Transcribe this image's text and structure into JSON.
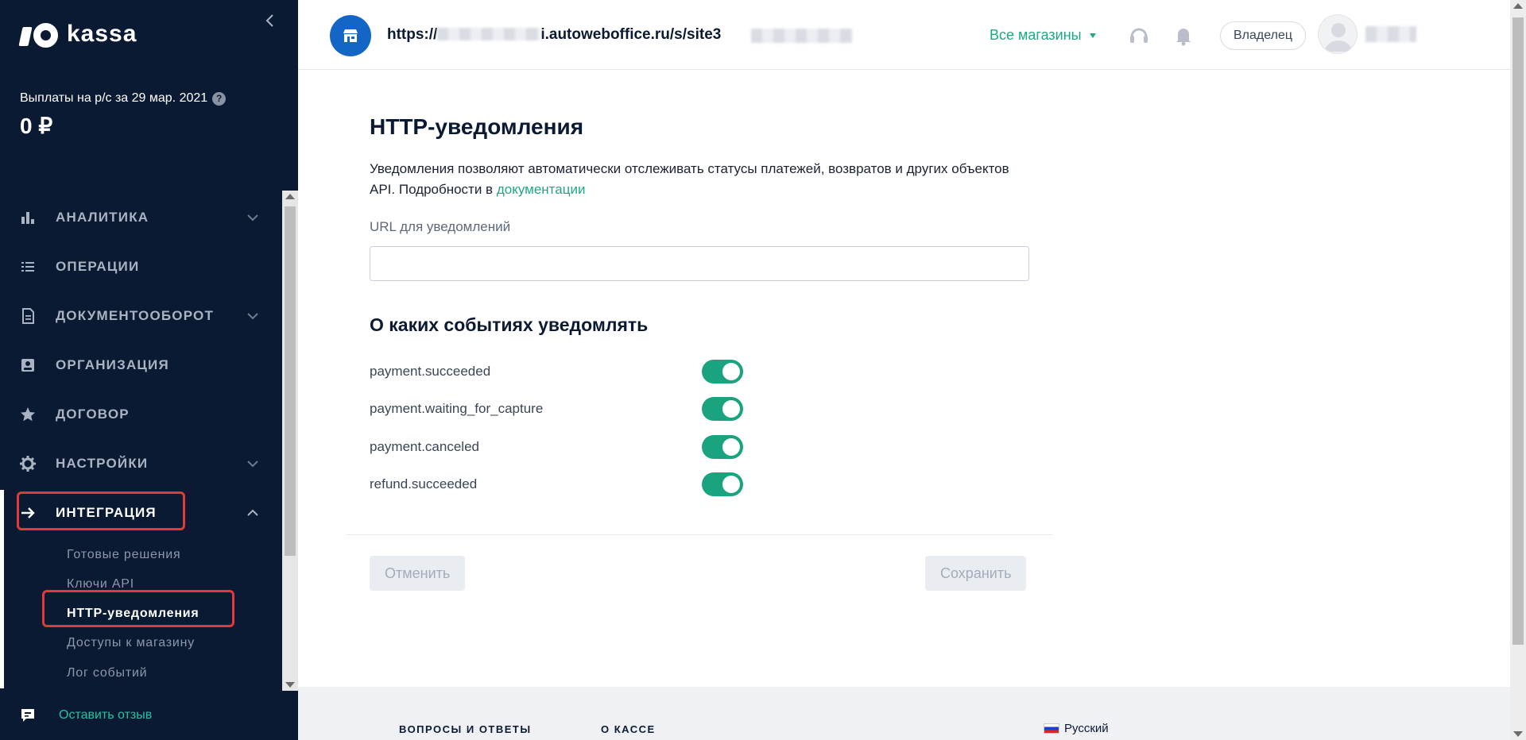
{
  "sidebar": {
    "logo_text": "kassa",
    "payout_label": "Выплаты на р/с за 29 мар. 2021",
    "payout_amount": "0 ₽",
    "nav": [
      {
        "label": "АНАЛИТИКА",
        "icon": "bar-chart-icon",
        "expandable": true
      },
      {
        "label": "ОПЕРАЦИИ",
        "icon": "list-icon",
        "expandable": false
      },
      {
        "label": "ДОКУМЕНТООБОРОТ",
        "icon": "document-icon",
        "expandable": true
      },
      {
        "label": "ОРГАНИЗАЦИЯ",
        "icon": "id-card-icon",
        "expandable": false
      },
      {
        "label": "ДОГОВОР",
        "icon": "star-icon",
        "expandable": false
      },
      {
        "label": "НАСТРОЙКИ",
        "icon": "gear-icon",
        "expandable": true
      },
      {
        "label": "ИНТЕГРАЦИЯ",
        "icon": "arrow-right-icon",
        "expandable": true,
        "expanded": true
      }
    ],
    "integration_sub": [
      {
        "label": "Готовые решения"
      },
      {
        "label": "Ключи API"
      },
      {
        "label": "HTTP-уведомления",
        "active": true
      },
      {
        "label": "Доступы к магазину"
      },
      {
        "label": "Лог событий"
      }
    ],
    "feedback_label": "Оставить отзыв"
  },
  "header": {
    "url_prefix": "https://",
    "url_suffix": "i.autoweboffice.ru/s/site3",
    "all_shops": "Все магазины",
    "owner": "Владелец"
  },
  "main": {
    "title": "HTTP-уведомления",
    "description": "Уведомления позволяют автоматически отслеживать статусы платежей, возвратов и других объектов API. Подробности в ",
    "doc_link": "документации",
    "url_label": "URL для уведомлений",
    "url_value": "",
    "events_title": "О каких событиях уведомлять",
    "events": [
      {
        "name": "payment.succeeded",
        "enabled": true
      },
      {
        "name": "payment.waiting_for_capture",
        "enabled": true
      },
      {
        "name": "payment.canceled",
        "enabled": true
      },
      {
        "name": "refund.succeeded",
        "enabled": true
      }
    ],
    "cancel_label": "Отменить",
    "save_label": "Сохранить"
  },
  "footer": {
    "faq": "ВОПРОСЫ И ОТВЕТЫ",
    "about": "О КАССЕ",
    "language": "Русский"
  },
  "colors": {
    "sidebar_bg": "#0b1a33",
    "accent_green": "#1ea885",
    "toggle_on": "#1aa37f",
    "highlight_red": "#e23a3a",
    "shop_avatar_blue": "#1366c6"
  }
}
